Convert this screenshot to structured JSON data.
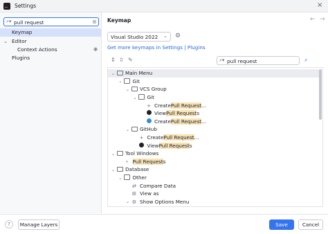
{
  "window": {
    "title": "Settings",
    "app_icon": "app-icon",
    "close_glyph": "×"
  },
  "sidebar": {
    "search": {
      "value": "pull request",
      "icon_glyph": "⌕▾",
      "clear_glyph": "⊗"
    },
    "items": [
      {
        "label": "Keymap",
        "selected": true
      },
      {
        "label": "Editor",
        "expander": "⌄"
      },
      {
        "label": "Context Actions",
        "icon": "eye-icon",
        "icon_glyph": "◉"
      },
      {
        "label": "Plugins"
      }
    ]
  },
  "main": {
    "title": "Keymap",
    "nav": {
      "back_glyph": "←",
      "forward_glyph": "→"
    },
    "keymap_select": {
      "value": "Visual Studio 2022",
      "chevron": "⌄",
      "gear_glyph": "⚙"
    },
    "link": "Get more keymaps in Settings | Plugins",
    "toolbar": {
      "expand_glyph": "⇕",
      "collapse_glyph": "⇳",
      "edit_glyph": "✎"
    },
    "tree_search": {
      "value": "pull request",
      "icon_glyph": "⌕▾",
      "find_glyph": "⌕"
    },
    "tree": [
      {
        "indent": 0,
        "tw": "⌄",
        "icon": "folder",
        "label": "Main Menu",
        "selected": true
      },
      {
        "indent": 1,
        "tw": "⌄",
        "icon": "folder",
        "label": "Git"
      },
      {
        "indent": 2,
        "tw": "⌄",
        "icon": "folder",
        "label": "VCS Group"
      },
      {
        "indent": 3,
        "tw": "⌄",
        "icon": "folder",
        "label": "Git"
      },
      {
        "indent": 4,
        "tw": "",
        "icon": "plus",
        "pre": "Create ",
        "hl": "Pull Request",
        "post": "..."
      },
      {
        "indent": 4,
        "tw": "",
        "icon": "github",
        "pre": "View ",
        "hl": "Pull Request",
        "post": "s"
      },
      {
        "indent": 4,
        "tw": "",
        "icon": "crucible",
        "pre": "Create ",
        "hl": "Pull Request",
        "post": "..."
      },
      {
        "indent": 2,
        "tw": "⌄",
        "icon": "folder",
        "label": "GitHub"
      },
      {
        "indent": 3,
        "tw": "",
        "icon": "plus",
        "pre": "Create ",
        "hl": "Pull Request",
        "post": "..."
      },
      {
        "indent": 3,
        "tw": "",
        "icon": "github",
        "pre": "View ",
        "hl": "Pull Request",
        "post": "s"
      },
      {
        "indent": 0,
        "tw": "⌄",
        "icon": "folder",
        "label": "Tool Windows"
      },
      {
        "indent": 1,
        "tw": "",
        "icon": "pull-request",
        "pre": "",
        "hl": "Pull Request",
        "post": "s"
      },
      {
        "indent": 0,
        "tw": "⌄",
        "icon": "folder",
        "label": "Database"
      },
      {
        "indent": 1,
        "tw": "⌄",
        "icon": "folder",
        "label": "Other"
      },
      {
        "indent": 2,
        "tw": "",
        "icon": "compare",
        "label": "Compare Data"
      },
      {
        "indent": 2,
        "tw": "",
        "icon": "view",
        "label": "View as"
      },
      {
        "indent": 2,
        "tw": "⌄",
        "icon": "gear",
        "label": "Show Options Menu"
      }
    ]
  },
  "footer": {
    "help_glyph": "?",
    "manage_layers": "Manage Layers",
    "save": "Save",
    "cancel": "Cancel"
  },
  "colors": {
    "accent": "#3574f0",
    "selection": "#d5e1fa",
    "highlight": "#f8e2b5",
    "link": "#2a66d9"
  }
}
